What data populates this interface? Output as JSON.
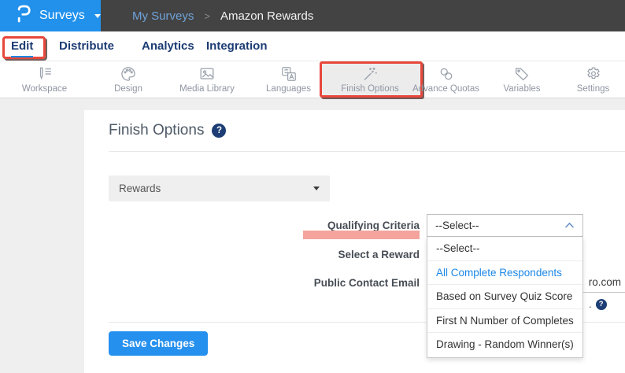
{
  "header": {
    "surveys_label": "Surveys",
    "breadcrumb": {
      "parent": "My Surveys",
      "separator": ">",
      "current": "Amazon Rewards"
    }
  },
  "nav": {
    "items": [
      {
        "label": "Edit",
        "active": true,
        "annotated": true
      },
      {
        "label": "Distribute"
      },
      {
        "label": "Analytics"
      },
      {
        "label": "Integration"
      }
    ]
  },
  "toolbar": {
    "items": [
      {
        "label": "Workspace",
        "icon": "workspace-icon"
      },
      {
        "label": "Design",
        "icon": "design-icon"
      },
      {
        "label": "Media Library",
        "icon": "media-library-icon"
      },
      {
        "label": "Languages",
        "icon": "languages-icon"
      },
      {
        "label": "Finish Options",
        "icon": "finish-options-icon",
        "annotated": true,
        "active": true
      },
      {
        "label": "Advance Quotas",
        "icon": "advance-quotas-icon"
      },
      {
        "label": "Variables",
        "icon": "variables-icon"
      },
      {
        "label": "Settings",
        "icon": "settings-icon"
      }
    ]
  },
  "main": {
    "title": "Finish Options",
    "title_help_icon": "help-icon",
    "mode_select": {
      "value": "Rewards"
    },
    "fields": [
      {
        "label": "Qualifying Criteria",
        "highlighted": true
      },
      {
        "label": "Select a Reward"
      },
      {
        "label": "Public Contact Email"
      }
    ],
    "email": {
      "visible_fragment": "ro.com",
      "helper_fragment": "."
    },
    "qualifying_dropdown": {
      "value": "--Select--",
      "options": [
        "--Select--",
        "All Complete Respondents",
        "Based on Survey Quiz Score",
        "First N Number of Completes",
        "Drawing - Random Winner(s)"
      ],
      "highlighted_option": "All Complete Respondents"
    },
    "save_button_label": "Save Changes"
  },
  "colors": {
    "header_blue": "#2191EC",
    "header_dark": "#434343",
    "breadcrumb_link": "#6FA3D9",
    "nav_text": "#1D3C74",
    "accent_blue": "#1B87E6",
    "annotation_red": "#E8473C",
    "highlight_pink": "#F4A49C",
    "help_navy": "#1D3E75",
    "save_button_blue": "#2590EE",
    "page_background": "#EFEFEF"
  }
}
